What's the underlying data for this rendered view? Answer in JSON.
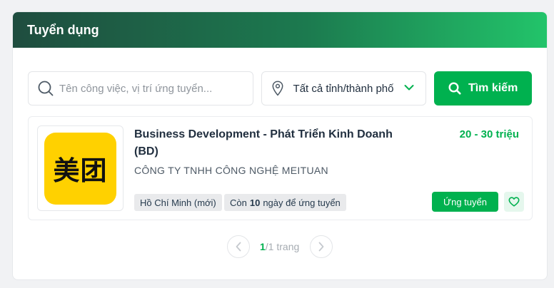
{
  "header": {
    "title": "Tuyển dụng"
  },
  "search": {
    "placeholder": "Tên công việc, vị trí ứng tuyển...",
    "location": "Tất cả tỉnh/thành phố",
    "button_label": "Tìm kiếm"
  },
  "job": {
    "logo_text": "美团",
    "title": "Business Development - Phát Triển Kinh Doanh (BD)",
    "salary": "20 - 30 triệu",
    "company": "CÔNG TY TNHH CÔNG NGHỆ MEITUAN",
    "location_tag": "Hồ Chí Minh (mới)",
    "days_prefix": "Còn",
    "days_left": "10",
    "days_suffix": "ngày để ứng tuyển",
    "apply_label": "Ứng tuyển"
  },
  "pagination": {
    "current": "1",
    "rest": "/1 trang"
  },
  "colors": {
    "brand_green": "#00b14f",
    "header_dark": "#1f4d3f",
    "logo_yellow": "#ffd100"
  },
  "icons": [
    "search-icon",
    "location-pin-icon",
    "chevron-down-icon",
    "heart-icon",
    "chevron-left-icon",
    "chevron-right-icon"
  ]
}
